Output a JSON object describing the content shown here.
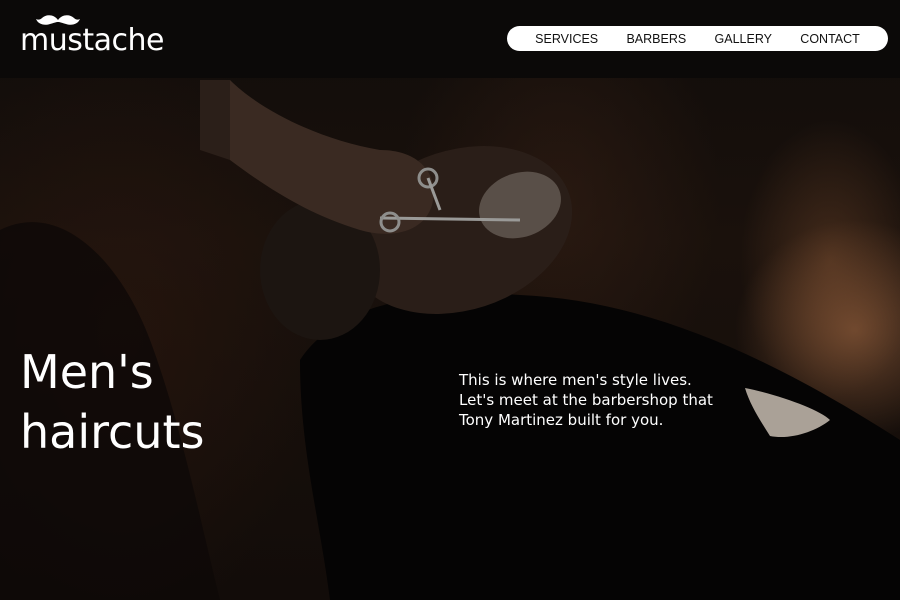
{
  "brand": {
    "name": "mustache",
    "logo_icon": "mustache-icon"
  },
  "nav": {
    "items": [
      {
        "label": "SERVICES"
      },
      {
        "label": "BARBERS"
      },
      {
        "label": "GALLERY"
      },
      {
        "label": "CONTACT"
      }
    ]
  },
  "hero": {
    "headline_line1": "Men's",
    "headline_line2": "haircuts",
    "tagline_line1": "This is where men's style lives.",
    "tagline_line2": "Let's meet at the barbershop that",
    "tagline_line3": "Tony Martinez built for you.",
    "background_image": "barber-trimming-beard-photo"
  },
  "colors": {
    "page_bg": "#0b0908",
    "nav_bg": "#ffffff",
    "text": "#ffffff",
    "nav_text": "#111111"
  }
}
